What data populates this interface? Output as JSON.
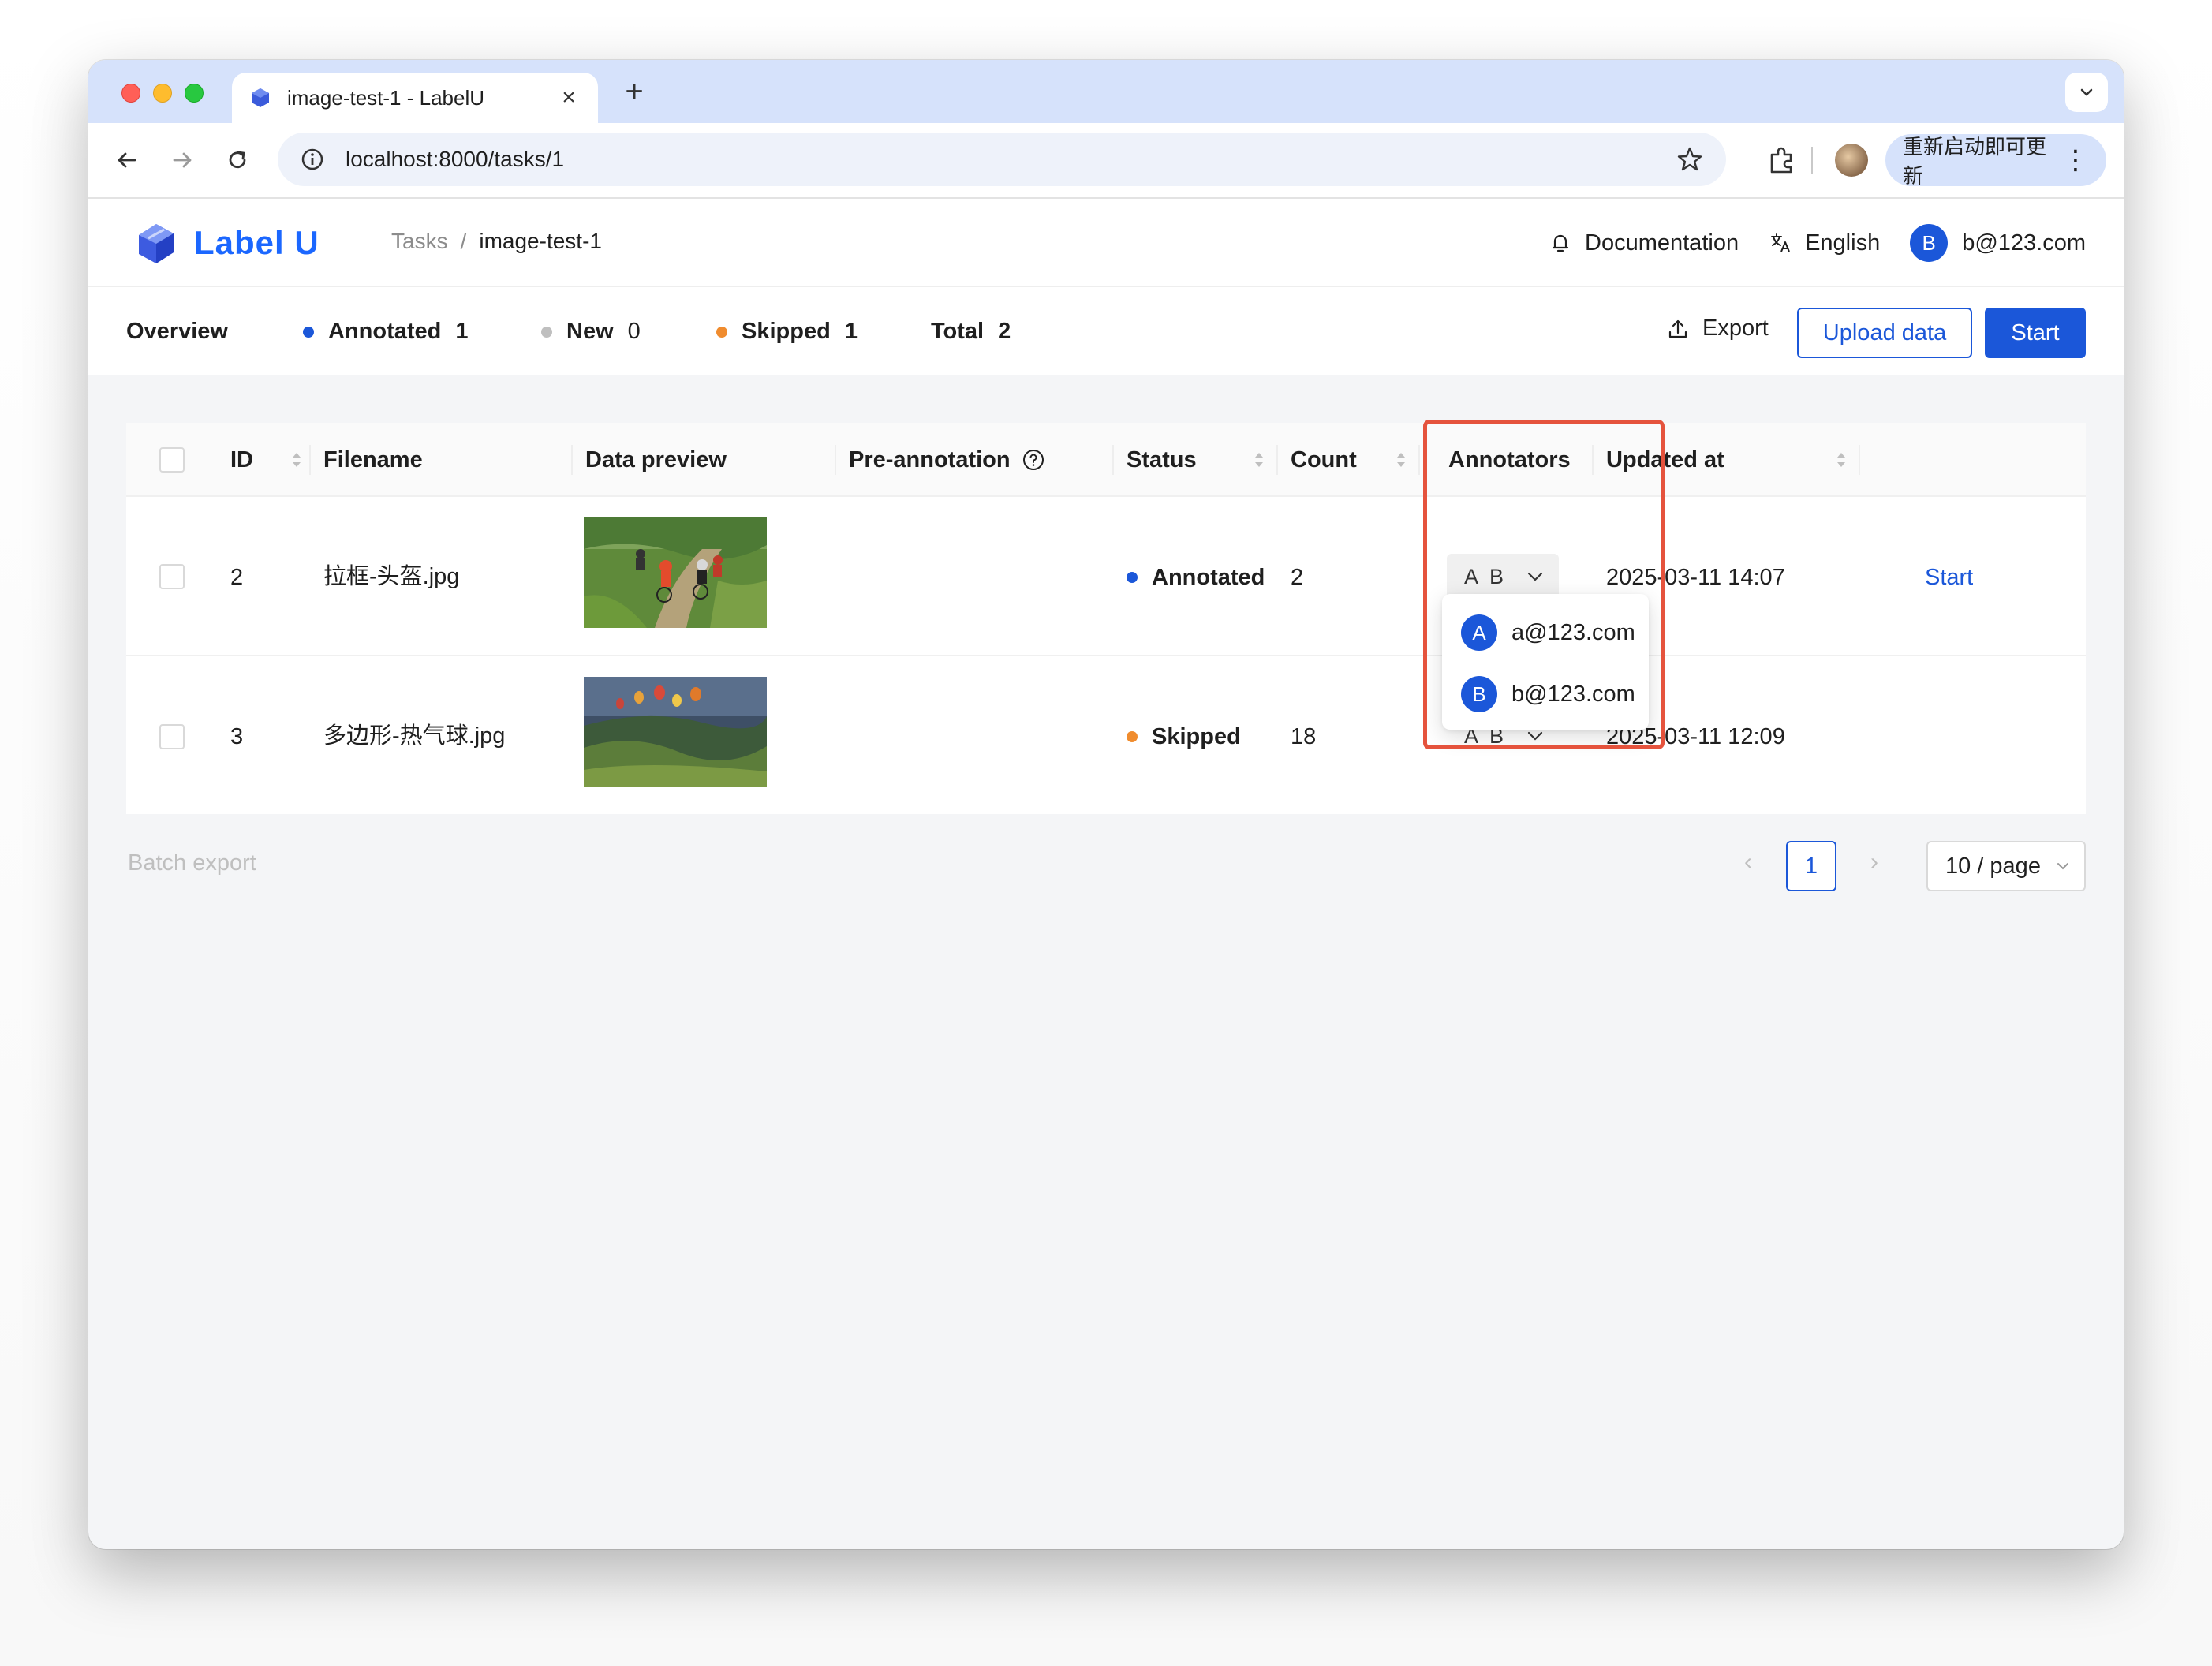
{
  "browser": {
    "tab_title": "image-test-1 - LabelU",
    "url": "localhost:8000/tasks/1",
    "update_button": "重新启动即可更新"
  },
  "app": {
    "logo_text": "Label U",
    "breadcrumb": {
      "parent": "Tasks",
      "separator": "/",
      "current": "image-test-1"
    },
    "header": {
      "documentation": "Documentation",
      "language": "English",
      "user_initial": "B",
      "user_email": "b@123.com"
    }
  },
  "summary": {
    "overview": "Overview",
    "annotated_label": "Annotated",
    "annotated_count": "1",
    "new_label": "New",
    "new_count": "0",
    "skipped_label": "Skipped",
    "skipped_count": "1",
    "total_label": "Total",
    "total_count": "2",
    "export": "Export",
    "upload": "Upload data",
    "start": "Start"
  },
  "colors": {
    "primary": "#1b57d9",
    "annotated": "#1b57d9",
    "new": "#bfbfbf",
    "skipped": "#f08c2e",
    "highlight": "#e5533d"
  },
  "table": {
    "headers": {
      "id": "ID",
      "filename": "Filename",
      "preview": "Data preview",
      "pre_annotation": "Pre-annotation",
      "status": "Status",
      "count": "Count",
      "annotators": "Annotators",
      "updated_at": "Updated at"
    },
    "rows": [
      {
        "id": "2",
        "filename": "拉框-头盔.jpg",
        "status": "Annotated",
        "count": "2",
        "annotators": [
          "A",
          "B"
        ],
        "updated_at": "2025-03-11 14:07",
        "action": "Start"
      },
      {
        "id": "3",
        "filename": "多边形-热气球.jpg",
        "status": "Skipped",
        "count": "18",
        "annotators": [
          "A",
          "B"
        ],
        "updated_at": "2025-03-11 12:09",
        "action": ""
      }
    ]
  },
  "annotator_dropdown": [
    {
      "initial": "A",
      "email": "a@123.com"
    },
    {
      "initial": "B",
      "email": "b@123.com"
    }
  ],
  "footer": {
    "batch_export": "Batch export",
    "current_page": "1",
    "page_size": "10 / page"
  }
}
